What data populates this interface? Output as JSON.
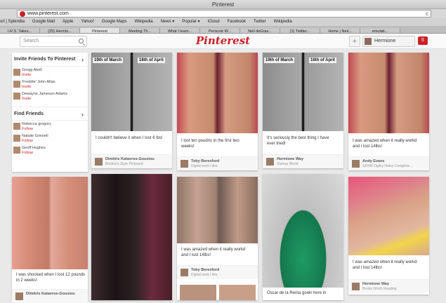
{
  "window": {
    "title": "Pinterest"
  },
  "address": {
    "url": "www.pinterest.com",
    "reload": "c"
  },
  "bookmarks": [
    "url | Splendia",
    "Google Mail",
    "Apple",
    "Yahoo!",
    "Google Maps",
    "Wikipedia",
    "News ▾",
    "Popular ▾",
    "iCloud",
    "Facebook",
    "Twitter",
    "Wikipedia"
  ],
  "tabs": [
    "I.R.S. Takes...",
    "(25) Hermio...",
    "Pinterest",
    "Meeting Th...",
    "What I learn...",
    "Periscok W...",
    "Neil deGras...",
    "(1) Twitter...",
    "Home | Neil...",
    "emulati..."
  ],
  "header": {
    "search_placeholder": "Search",
    "logo": "Pinterest",
    "plus": "+",
    "user": "Hermione",
    "notifications": "5"
  },
  "sidebar": {
    "invite_title": "Invite Friends To Pinterest",
    "invite": [
      {
        "name": "Gregg Abell",
        "action": "Invite"
      },
      {
        "name": "'Freddie' John Allan",
        "action": "Invite"
      },
      {
        "name": "Dewayne Jameson Adams",
        "action": "Invite"
      }
    ],
    "find_title": "Find Friends",
    "find": [
      {
        "name": "Rebecca gregory",
        "action": "Follow"
      },
      {
        "name": "Natalie Grinnell",
        "action": "Follow"
      },
      {
        "name": "Geoff Hughes",
        "action": "Follow"
      }
    ]
  },
  "pins": {
    "p1": {
      "cap1": "19th of March",
      "cap2": "16th of April",
      "desc": "I couldn't believe it when I lost 6 lbs!",
      "user": "Dimitris Katavros-Gousiou",
      "board": "Bimbiis's Style Pinboard"
    },
    "p2": {
      "desc": "I lost ten poudns in the first two weeks!",
      "user": "Toby Beresford",
      "board": "Digital work I like"
    },
    "p3": {
      "cap1": "19th of March",
      "cap2": "16th of April",
      "desc": "It's seriously the best thing I have ever tried!",
      "user": "Hermione Way",
      "board": "Startup World"
    },
    "p4": {
      "desc": "I was amazed when it really workd and I lost 14lbs!",
      "user": "Andy Evans",
      "board": "SASW Ogilvy Notes Complete..."
    },
    "p5": {
      "desc": "I was shocked when I lost 12 pounds in 2 weeks!",
      "user": "Dimitris Katavros-Gousiou",
      "board": ""
    },
    "p7": {
      "desc": "I was amazed when it really workd and I lost 14lbs!",
      "user": "Toby Beresford",
      "board": "Digital work I like"
    },
    "p8": {
      "desc": "Oscar de la Renta gown here in"
    },
    "p9": {
      "desc": "I was amazed when it really workd and I lost 14lbs!",
      "user": "Hermione Way",
      "board": "Books Worth Reading"
    }
  }
}
